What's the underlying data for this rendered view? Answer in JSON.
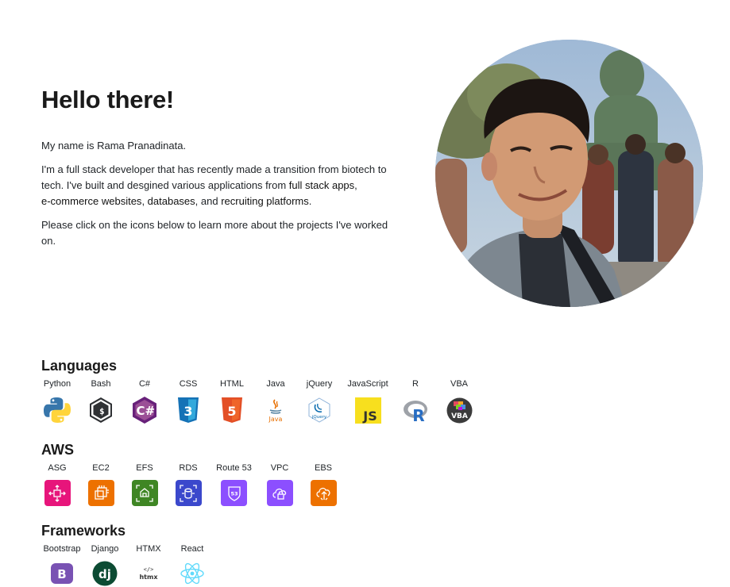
{
  "intro": {
    "heading": "Hello there!",
    "name_line": "My name is Rama Pranadinata.",
    "bio_prefix": "I'm a full stack developer that has recently made a transition from biotech to tech. I've built and desgined various applications from ",
    "link_full_stack": "full stack apps",
    "bio_mid1": ", ",
    "link_ecommerce": "e-commerce websites",
    "bio_mid2": ", ",
    "link_databases": "databases",
    "bio_mid3": ", and ",
    "link_recruiting": "recruiting platforms",
    "bio_suffix": ".",
    "cta": "Please click on the icons below to learn more about the projects I've worked on."
  },
  "languages": {
    "title": "Languages",
    "items": [
      {
        "label": "Python",
        "icon": "python-icon"
      },
      {
        "label": "Bash",
        "icon": "bash-icon"
      },
      {
        "label": "C#",
        "icon": "csharp-icon"
      },
      {
        "label": "CSS",
        "icon": "css-icon"
      },
      {
        "label": "HTML",
        "icon": "html-icon"
      },
      {
        "label": "Java",
        "icon": "java-icon"
      },
      {
        "label": "jQuery",
        "icon": "jquery-icon"
      },
      {
        "label": "JavaScript",
        "icon": "javascript-icon"
      },
      {
        "label": "R",
        "icon": "r-icon"
      },
      {
        "label": "VBA",
        "icon": "vba-icon"
      }
    ],
    "icon_texts": {
      "java": "Java",
      "jquery": "jQuery",
      "js": "JS",
      "r": "R",
      "vba": "VBA",
      "csharp": "C#",
      "html": "5",
      "css": "3"
    }
  },
  "aws": {
    "title": "AWS",
    "items": [
      {
        "label": "ASG",
        "icon": "asg-icon",
        "color": "#e7157b"
      },
      {
        "label": "EC2",
        "icon": "ec2-icon",
        "color": "#ed7100"
      },
      {
        "label": "EFS",
        "icon": "efs-icon",
        "color": "#3f8624"
      },
      {
        "label": "RDS",
        "icon": "rds-icon",
        "color": "#3b48cc"
      },
      {
        "label": "Route 53",
        "icon": "route53-icon",
        "color": "#8c4fff"
      },
      {
        "label": "VPC",
        "icon": "vpc-icon",
        "color": "#8c4fff"
      },
      {
        "label": "EBS",
        "icon": "ebs-icon",
        "color": "#ed7100"
      }
    ],
    "icon_texts": {
      "route53": "53"
    }
  },
  "frameworks": {
    "title": "Frameworks",
    "items": [
      {
        "label": "Bootstrap",
        "icon": "bootstrap-icon",
        "color": "#7952b3"
      },
      {
        "label": "Django",
        "icon": "django-icon",
        "color": "#0c4b33"
      },
      {
        "label": "HTMX",
        "icon": "htmx-icon",
        "color": "#3d72d7"
      },
      {
        "label": "React",
        "icon": "react-icon",
        "color": "#61dafb"
      }
    ],
    "icon_texts": {
      "bootstrap": "B",
      "django": "dj",
      "htmx_tag": "</>",
      "htmx": "htmx"
    }
  }
}
